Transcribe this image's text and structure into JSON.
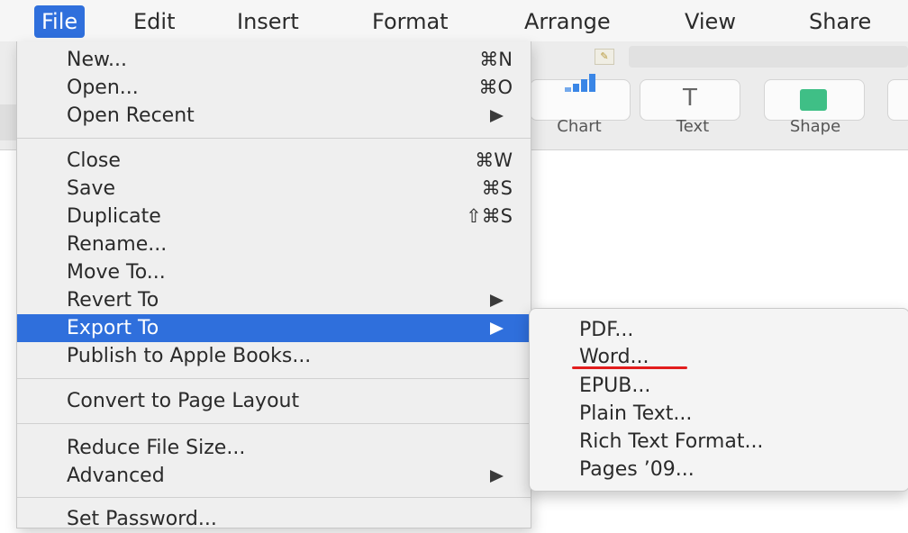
{
  "menubar": {
    "items": [
      "File",
      "Edit",
      "Insert",
      "Format",
      "Arrange",
      "View",
      "Share"
    ]
  },
  "toolbar": {
    "doc_icon": "pages-document-icon",
    "buttons": [
      {
        "label": "Chart",
        "icon": "chart-icon"
      },
      {
        "label": "Text",
        "icon": "text-icon"
      },
      {
        "label": "Shape",
        "icon": "shape-icon"
      }
    ]
  },
  "file_menu": {
    "items": [
      {
        "label": "New...",
        "shortcut": "⌘N"
      },
      {
        "label": "Open...",
        "shortcut": "⌘O"
      },
      {
        "label": "Open Recent",
        "submenu": true
      },
      {
        "label": "Close",
        "shortcut": "⌘W"
      },
      {
        "label": "Save",
        "shortcut": "⌘S"
      },
      {
        "label": "Duplicate",
        "shortcut": "⇧⌘S"
      },
      {
        "label": "Rename..."
      },
      {
        "label": "Move To..."
      },
      {
        "label": "Revert To",
        "submenu": true
      },
      {
        "label": "Export To",
        "submenu": true,
        "highlighted": true
      },
      {
        "label": "Publish to Apple Books..."
      },
      {
        "label": "Convert to Page Layout"
      },
      {
        "label": "Reduce File Size..."
      },
      {
        "label": "Advanced",
        "submenu": true
      },
      {
        "label": "Set Password..."
      }
    ]
  },
  "export_menu": {
    "items": [
      "PDF...",
      "Word...",
      "EPUB...",
      "Plain Text...",
      "Rich Text Format...",
      "Pages ’09..."
    ],
    "annotated_item": "Word...",
    "annotation_color": "#e21d1d"
  },
  "colors": {
    "highlight": "#2f6fdc",
    "shape_icon": "#3fbf86",
    "chart_icon": "#3a86e6"
  }
}
